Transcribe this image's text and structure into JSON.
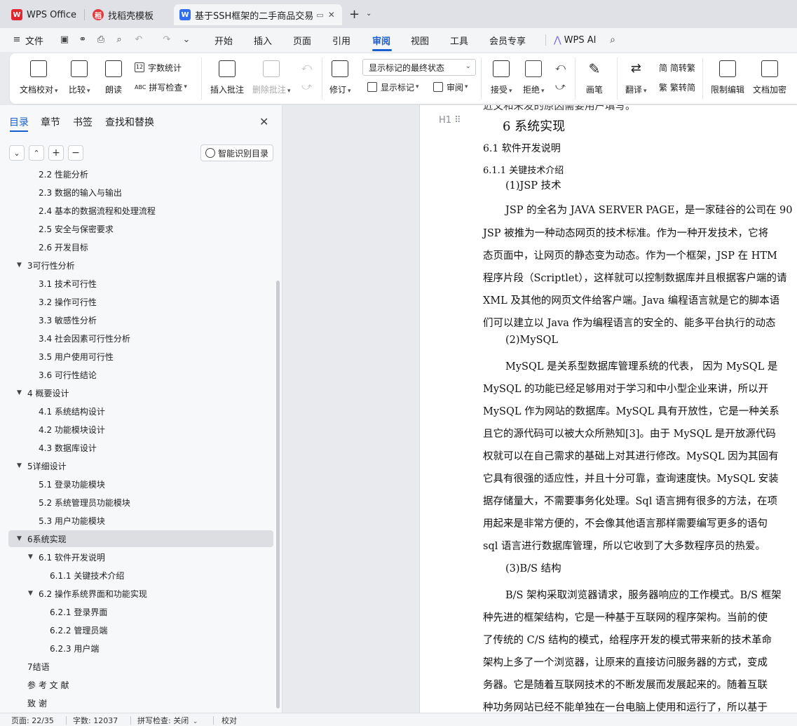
{
  "tabs": [
    {
      "label": "WPS Office",
      "icon": "wps-logo-icon"
    },
    {
      "label": "找稻壳模板",
      "icon": "docer-icon"
    },
    {
      "label": "基于SSH框架的二手商品交易",
      "icon": "wps-writer-icon"
    }
  ],
  "menu": {
    "file": "文件",
    "items": [
      "开始",
      "插入",
      "页面",
      "引用",
      "审阅",
      "视图",
      "工具",
      "会员专享"
    ],
    "active": "审阅",
    "wps_ai": "WPS AI"
  },
  "ribbon": {
    "doc_proof": "文档校对",
    "compare": "比较",
    "read_aloud": "朗读",
    "word_count": "字数统计",
    "spell_check": "拼写检查",
    "insert_comment": "插入批注",
    "delete_comment": "删除批注",
    "revise": "修订",
    "markup_state": "显示标记的最终状态",
    "show_markup": "显示标记",
    "review": "审阅",
    "accept": "接受",
    "reject": "拒绝",
    "ink": "画笔",
    "translate": "翻译",
    "to_traditional": "简转繁",
    "to_simplified": "繁转简",
    "restrict_edit": "限制编辑",
    "doc_encrypt": "文档加密"
  },
  "nav": {
    "tabs": [
      "目录",
      "章节",
      "书签",
      "查找和替换"
    ],
    "active_tab": "目录",
    "smart_toc": "智能识别目录",
    "toc": [
      {
        "text": "2.2 性能分析",
        "level": 2
      },
      {
        "text": "2.3  数据的输入与输出",
        "level": 2
      },
      {
        "text": "2.4  基本的数据流程和处理流程",
        "level": 2
      },
      {
        "text": "2.5  安全与保密要求",
        "level": 2
      },
      {
        "text": "2.6  开发目标",
        "level": 2
      },
      {
        "text": "3可行性分析",
        "level": 1
      },
      {
        "text": "3.1 技术可行性",
        "level": 2
      },
      {
        "text": "3.2 操作可行性",
        "level": 2
      },
      {
        "text": "3.3 敏感性分析",
        "level": 2
      },
      {
        "text": "3.4 社会因素可行性分析",
        "level": 2
      },
      {
        "text": "3.5 用户使用可行性",
        "level": 2
      },
      {
        "text": "3.6 可行性结论",
        "level": 2
      },
      {
        "text": "4 概要设计",
        "level": 1
      },
      {
        "text": "4.1 系统结构设计",
        "level": 2
      },
      {
        "text": "4.2 功能模块设计",
        "level": 2
      },
      {
        "text": "4.3 数据库设计",
        "level": 2
      },
      {
        "text": "5详细设计",
        "level": 1
      },
      {
        "text": "5.1 登录功能模块",
        "level": 2
      },
      {
        "text": "5.2 系统管理员功能模块",
        "level": 2
      },
      {
        "text": "5.3    用户功能模块",
        "level": 2
      },
      {
        "text": "6系统实现",
        "level": 1
      },
      {
        "text": "6.1    软件开发说明",
        "level": 2
      },
      {
        "text": "6.1.1    关键技术介绍",
        "level": 3
      },
      {
        "text": "6.2    操作系统界面和功能实现",
        "level": 2
      },
      {
        "text": "6.2.1    登录界面",
        "level": 3
      },
      {
        "text": "6.2.2    管理员端",
        "level": 3
      },
      {
        "text": "6.2.3    用户端",
        "level": 3
      },
      {
        "text": "7结语",
        "level": 1
      },
      {
        "text": "参  考  文  献",
        "level": 1
      },
      {
        "text": "致          谢",
        "level": 1
      }
    ]
  },
  "document": {
    "top_cut": "近文和未发的原因需要用户填写。",
    "h1": "6   系统实现",
    "h2": "6.1    软件开发说明",
    "h3": "6.1.1    关键技术介绍",
    "lines": [
      "(1)JSP 技术",
      "JSP 的全名为 JAVA SERVER PAGE，是一家硅谷的公司在 90",
      "JSP 被推为一种动态网页的技术标准。作为一种开发技术，它将",
      "态页面中，让网页的静态变为动态。作为一个框架，JSP 在 HTM",
      "程序片段（Scriptlet），这样就可以控制数据库并且根据客户端的请",
      "XML 及其他的网页文件给客户端。Java 编程语言就是它的脚本语",
      "们可以建立以 Java 作为编程语言的安全的、能多平台执行的动态",
      "(2)MySQL",
      "MySQL  是关系型数据库管理系统的代表，   因为 MySQL 是",
      "MySQL 的功能已经足够用对于学习和中小型企业来讲，所以开",
      "MySQL 作为网站的数据库。MySQL 具有开放性，它是一种关系",
      "且它的源代码可以被大众所熟知[3]。由于 MySQL 是开放源代码",
      "权就可以在自己需求的基础上对其进行修改。MySQL 因为其固有",
      "它具有很强的适应性，并且十分可靠，查询速度快。MySQL 安装",
      "据存储量大，不需要事务化处理。Sql 语言拥有很多的方法，在项",
      "用起来是非常方便的，不会像其他语言那样需要编写更多的语句",
      "sql 语言进行数据库管理，所以它收到了大多数程序员的热爱。",
      "(3)B/S 结构",
      "B/S 架构采取浏览器请求，服务器响应的工作模式。B/S 框架",
      "种先进的框架结构，它是一种基于互联网的程序架构。当前的使",
      "了传统的 C/S 结构的模式，给程序开发的模式带来新的技术革命",
      "架构上多了一个浏览器，让原来的直接访问服务器的方式，变成",
      "务器。它是随着互联网技术的不断发展而发展起来的。随着互联",
      "种功务网站已经不能单独在一台电脑上使用和运行了，所以基于"
    ]
  },
  "status": {
    "page": "页面: 22/35",
    "words": "字数: 12037",
    "spell": "拼写检查: 关闭",
    "proof": "校对"
  },
  "colors": {
    "accent": "#1a5fd1",
    "wps_red": "#e0282e",
    "writer_blue": "#2f6ff0"
  }
}
